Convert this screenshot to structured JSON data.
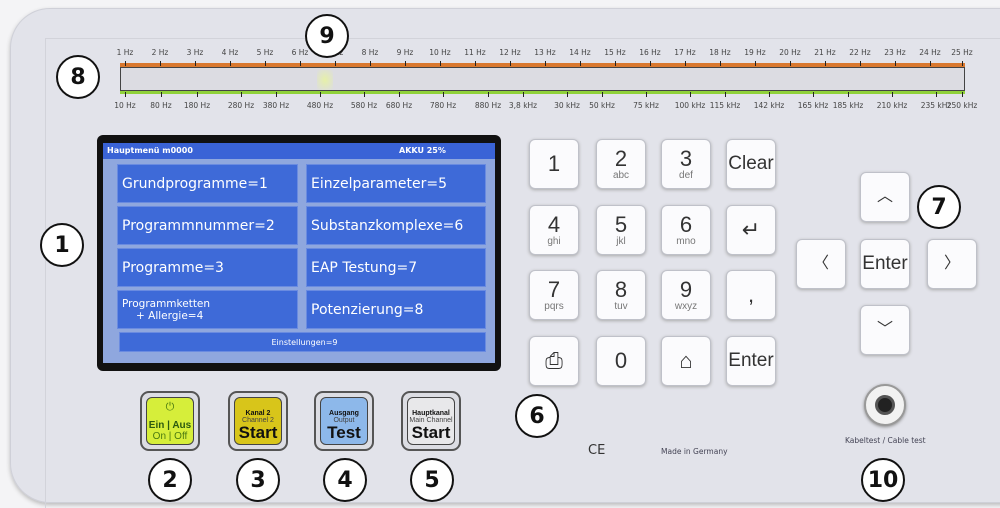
{
  "scale": {
    "top_labels": [
      "1 Hz",
      "2 Hz",
      "3 Hz",
      "4 Hz",
      "5 Hz",
      "6 Hz",
      "7 Hz",
      "8 Hz",
      "9 Hz",
      "10 Hz",
      "11 Hz",
      "12 Hz",
      "13 Hz",
      "14 Hz",
      "15 Hz",
      "16 Hz",
      "17 Hz",
      "18 Hz",
      "19 Hz",
      "20 Hz",
      "21 Hz",
      "22 Hz",
      "23 Hz",
      "24 Hz",
      "25 Hz"
    ],
    "bottom_labels": [
      "10 Hz",
      "80 Hz",
      "180 Hz",
      "280 Hz",
      "380 Hz",
      "480 Hz",
      "580 Hz",
      "680 Hz",
      "780 Hz",
      "880 Hz",
      "3,8 kHz",
      "30 kHz",
      "50 kHz",
      "75 kHz",
      "100 kHz",
      "115 kHz",
      "142 kHz",
      "165 kHz",
      "185 kHz",
      "210 kHz",
      "235 kHz",
      "250 kHz"
    ],
    "top_color": "#d9782e",
    "bottom_color": "#8fd13a"
  },
  "lcd": {
    "title": "Hauptmenü m0000",
    "battery": "AKKU 25%",
    "items": [
      "Grundprogramme=1",
      "Programmnummer=2",
      "Programme=3",
      "Programmketten",
      "+ Allergie=4",
      "Einzelparameter=5",
      "Substanzkomplexe=6",
      "EAP Testung=7",
      "Potenzierung=8"
    ],
    "footer": "Einstellungen=9"
  },
  "keypad": [
    {
      "n": "1",
      "s": ""
    },
    {
      "n": "2",
      "s": "abc"
    },
    {
      "n": "3",
      "s": "def"
    },
    {
      "n": "Clear",
      "s": ""
    },
    {
      "n": "4",
      "s": "ghi"
    },
    {
      "n": "5",
      "s": "jkl"
    },
    {
      "n": "6",
      "s": "mno"
    },
    {
      "n": "↵",
      "s": ""
    },
    {
      "n": "7",
      "s": "pqrs"
    },
    {
      "n": "8",
      "s": "tuv"
    },
    {
      "n": "9",
      "s": "wxyz"
    },
    {
      "n": ",",
      "s": ""
    },
    {
      "n": "⎙",
      "s": ""
    },
    {
      "n": "0",
      "s": ""
    },
    {
      "n": "⌂",
      "s": ""
    },
    {
      "n": "Enter",
      "s": ""
    }
  ],
  "nav": {
    "up": "︿",
    "down": "﹀",
    "left": "〈",
    "right": "〉",
    "enter": "Enter"
  },
  "buttons": [
    {
      "t1": "Ein | Aus",
      "t2": "On | Off",
      "big": "",
      "color": "#d6ee3a",
      "icon": "power-icon"
    },
    {
      "t1": "Kanal 2",
      "t2": "Channel 2",
      "big": "Start",
      "color": "#d8c51a"
    },
    {
      "t1": "Ausgang",
      "t2": "Output",
      "big": "Test",
      "color": "#8db8ea"
    },
    {
      "t1": "Hauptkanal",
      "t2": "Main Channel",
      "big": "Start",
      "color": "#e8e8ea"
    }
  ],
  "labels": {
    "ce": "CE",
    "made": "Made in Germany",
    "cable": "Kabeltest / Cable test"
  },
  "callouts": [
    "1",
    "2",
    "3",
    "4",
    "5",
    "6",
    "7",
    "8",
    "9",
    "10"
  ]
}
